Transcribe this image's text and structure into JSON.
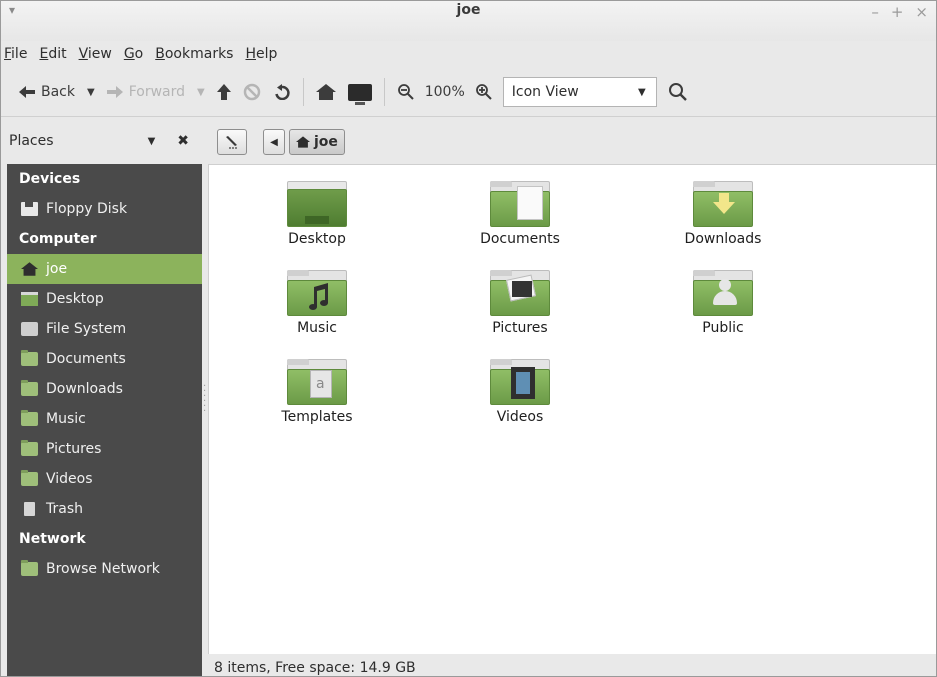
{
  "window": {
    "title": "joe",
    "menu_arrow": "▾",
    "controls": [
      "–",
      "+",
      "×"
    ]
  },
  "menubar": {
    "items": [
      "File",
      "Edit",
      "View",
      "Go",
      "Bookmarks",
      "Help"
    ]
  },
  "toolbar": {
    "back_label": "Back",
    "forward_label": "Forward",
    "zoom_level": "100%",
    "view_mode": "Icon View"
  },
  "places": {
    "header": "Places"
  },
  "breadcrumb": {
    "current": "joe"
  },
  "sidebar": {
    "sections": [
      {
        "title": "Devices",
        "items": [
          {
            "label": "Floppy Disk",
            "icon": "floppy-disk-icon"
          }
        ]
      },
      {
        "title": "Computer",
        "items": [
          {
            "label": "joe",
            "icon": "home-icon",
            "active": true
          },
          {
            "label": "Desktop",
            "icon": "desktop-icon"
          },
          {
            "label": "File System",
            "icon": "drive-icon"
          },
          {
            "label": "Documents",
            "icon": "folder-documents-icon"
          },
          {
            "label": "Downloads",
            "icon": "folder-downloads-icon"
          },
          {
            "label": "Music",
            "icon": "folder-music-icon"
          },
          {
            "label": "Pictures",
            "icon": "folder-pictures-icon"
          },
          {
            "label": "Videos",
            "icon": "folder-videos-icon"
          },
          {
            "label": "Trash",
            "icon": "trash-icon"
          }
        ]
      },
      {
        "title": "Network",
        "items": [
          {
            "label": "Browse Network",
            "icon": "network-icon"
          }
        ]
      }
    ]
  },
  "files": [
    {
      "label": "Desktop",
      "icon": "desktop-folder-icon"
    },
    {
      "label": "Documents",
      "icon": "documents-folder-icon"
    },
    {
      "label": "Downloads",
      "icon": "downloads-folder-icon"
    },
    {
      "label": "Music",
      "icon": "music-folder-icon"
    },
    {
      "label": "Pictures",
      "icon": "pictures-folder-icon"
    },
    {
      "label": "Public",
      "icon": "public-folder-icon"
    },
    {
      "label": "Templates",
      "icon": "templates-folder-icon"
    },
    {
      "label": "Videos",
      "icon": "videos-folder-icon"
    }
  ],
  "status": {
    "text": "8 items, Free space: 14.9 GB"
  },
  "colors": {
    "accent": "#8cb35c",
    "sidebar_bg": "#4a4a4a",
    "folder_green": "#7faa57"
  }
}
